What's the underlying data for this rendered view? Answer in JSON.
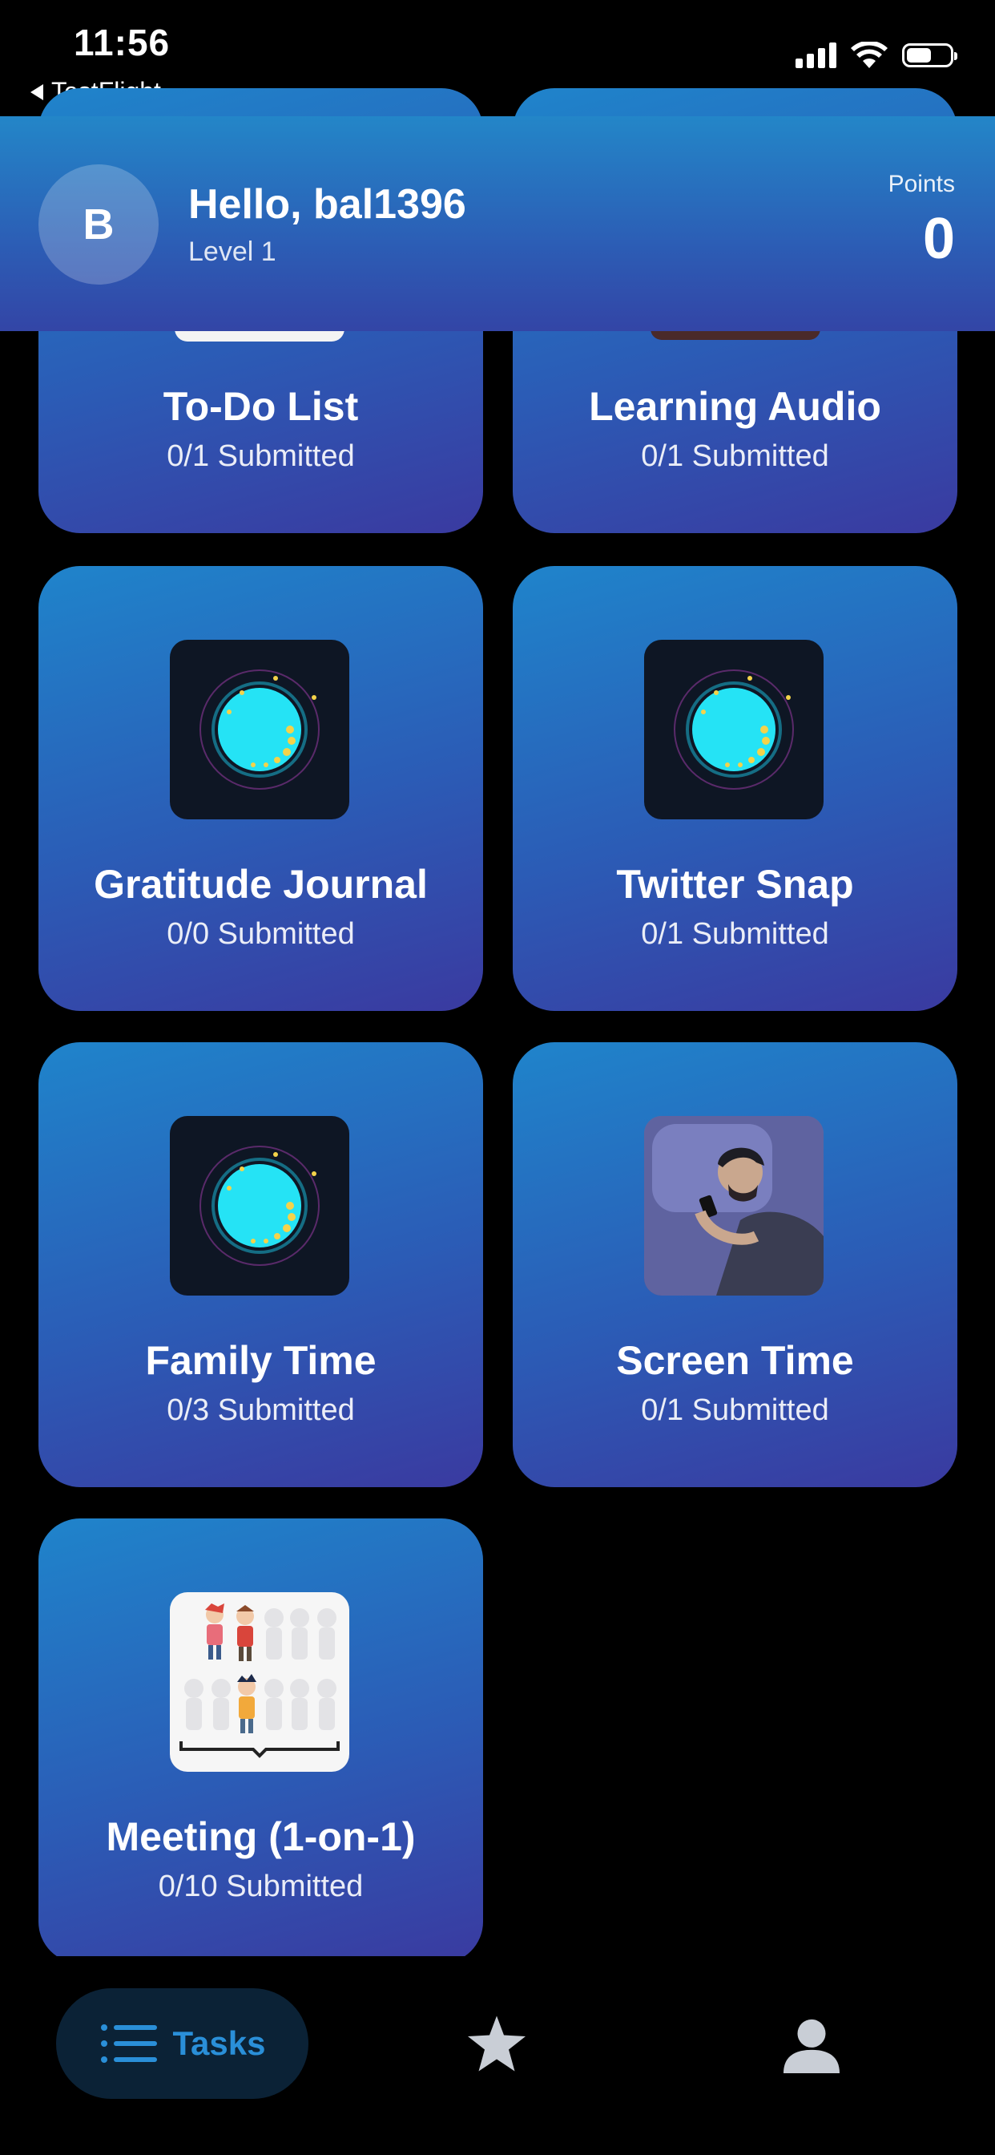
{
  "status_bar": {
    "time": "11:56",
    "back_label": "TestFlight"
  },
  "header": {
    "avatar_initial": "B",
    "greeting": "Hello, bal1396",
    "level": "Level 1",
    "points_label": "Points",
    "points_value": "0"
  },
  "tasks": [
    {
      "title": "To-Do List",
      "submitted": "0/1 Submitted"
    },
    {
      "title": "Learning Audio",
      "submitted": "0/1 Submitted"
    },
    {
      "title": "Gratitude Journal",
      "submitted": "0/0 Submitted",
      "image": "glowing-orb-icon"
    },
    {
      "title": "Twitter Snap",
      "submitted": "0/1 Submitted",
      "image": "glowing-orb-icon"
    },
    {
      "title": "Family Time",
      "submitted": "0/3 Submitted",
      "image": "glowing-orb-icon"
    },
    {
      "title": "Screen Time",
      "submitted": "0/1 Submitted",
      "image": "person-on-phone-illustration"
    },
    {
      "title": "Meeting (1-on-1)",
      "submitted": "0/10 Submitted",
      "image": "people-group-illustration"
    }
  ],
  "tab_bar": {
    "tasks_label": "Tasks",
    "active_color": "#2a8fd8",
    "inactive_color": "#c9ced6"
  },
  "colors": {
    "header_top": "#2386c8",
    "header_bottom": "#3345a6",
    "card_top": "#1f84cb",
    "card_bottom": "#3a3aa0",
    "background": "#000000"
  }
}
